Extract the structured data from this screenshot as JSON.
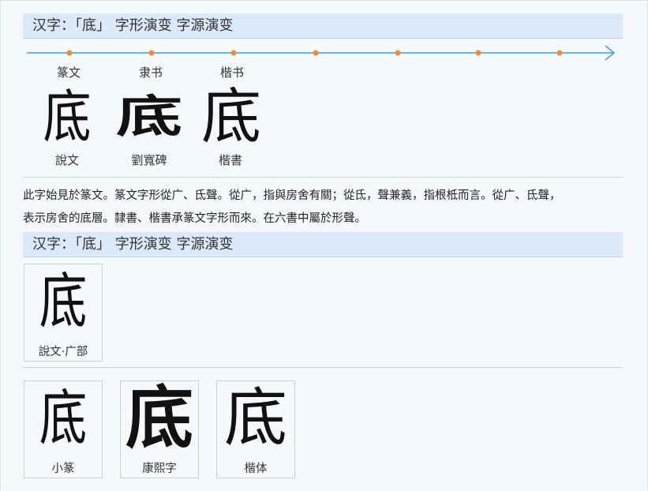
{
  "sections": [
    {
      "heading": "汉字：「底」 字形演变 字源演变"
    },
    {
      "heading": "汉字：「底」 字形演变 字源演变"
    }
  ],
  "timeline": {
    "eras": [
      "篆文",
      "隶书",
      "楷书"
    ],
    "accent": "#3aa3dc",
    "dot_color": "#f08a3c"
  },
  "evolution": [
    {
      "glyph": "底",
      "source": "說文"
    },
    {
      "glyph": "底",
      "source": "劉寬碑"
    },
    {
      "glyph": "底",
      "source": "楷書"
    }
  ],
  "description": {
    "line1": "此字始見於篆文。篆文字形從广、氐聲。從广，指與房舍有關；從氐，聲兼義，指根柢而言。從广、氐聲，",
    "line2": "表示房舍的底層。隸書、楷書承篆文字形而來。在六書中屬於形聲。"
  },
  "cards_top": [
    {
      "glyph": "底",
      "caption": "說文·广部"
    }
  ],
  "cards_bottom": [
    {
      "glyph": "底",
      "caption": "小篆"
    },
    {
      "glyph": "底",
      "caption": "康熙字"
    },
    {
      "glyph": "底",
      "caption": "楷体"
    }
  ]
}
